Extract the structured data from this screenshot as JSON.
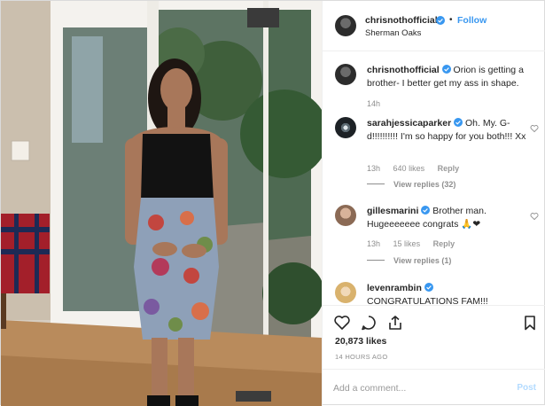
{
  "post": {
    "username": "chrisnothofficial",
    "follow_label": "Follow",
    "dot": "•",
    "location": "Sherman Oaks"
  },
  "caption": {
    "username": "chrisnothofficial",
    "text": "Orion is getting a brother- I better get my ass in shape.",
    "time": "14h"
  },
  "comments": [
    {
      "username": "sarahjessicaparker",
      "text": "Oh. My. G-d!!!!!!!!!! I'm so happy for you both!!! Xx",
      "time": "13h",
      "likes": "640 likes",
      "reply_label": "Reply",
      "view_replies": "View replies (32)"
    },
    {
      "username": "gillesmarini",
      "text": "Brother man. Hugeeeeeee congrats 🙏❤",
      "time": "13h",
      "likes": "15 likes",
      "reply_label": "Reply",
      "view_replies": "View replies (1)"
    },
    {
      "username": "levenrambin",
      "text": "CONGRATULATIONS FAM!!!"
    }
  ],
  "actions": {
    "like_icon": "heart-icon",
    "comment_icon": "comment-icon",
    "share_icon": "share-icon",
    "save_icon": "bookmark-icon",
    "likes": "20,873 likes",
    "time_ago": "14 HOURS AGO"
  },
  "add_comment": {
    "placeholder": "Add a comment...",
    "post_label": "Post"
  },
  "colors": {
    "link_blue": "#3897f0",
    "verified_blue": "#3897f0",
    "post_disabled": "#b3dbff",
    "muted_text": "#8e8e8e"
  }
}
